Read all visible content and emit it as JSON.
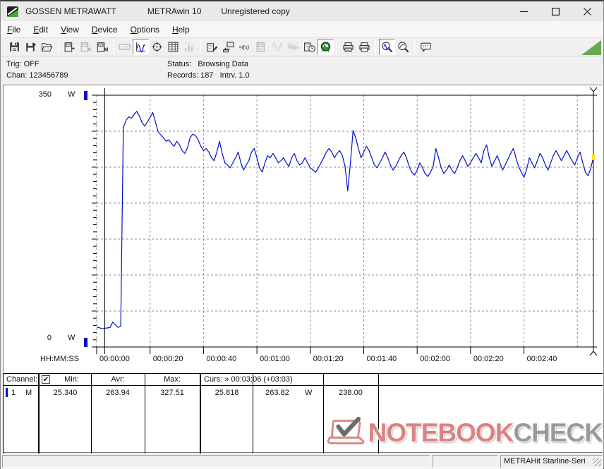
{
  "window": {
    "title_brand": "GOSSEN METRAWATT",
    "title_app": "METRAwin 10",
    "title_license": "Unregistered copy"
  },
  "menu": {
    "items": [
      {
        "label": "File"
      },
      {
        "label": "Edit"
      },
      {
        "label": "View"
      },
      {
        "label": "Device"
      },
      {
        "label": "Options"
      },
      {
        "label": "Help"
      }
    ]
  },
  "toolbar": {
    "buttons": [
      {
        "icon": "save-icon"
      },
      {
        "icon": "save-data-icon"
      },
      {
        "icon": "open-file-icon"
      },
      {
        "sep": true
      },
      {
        "icon": "device-read-icon"
      },
      {
        "icon": "device-clear-icon",
        "disabled": true
      },
      {
        "icon": "device-memory-icon"
      },
      {
        "sep": true
      },
      {
        "icon": "lcd-display-icon",
        "disabled": true
      },
      {
        "icon": "chart-view-icon",
        "pressed": true
      },
      {
        "icon": "cursor-crosshair-icon"
      },
      {
        "icon": "table-view-icon"
      },
      {
        "icon": "histogram-view-icon",
        "disabled": true
      },
      {
        "sep": true
      },
      {
        "icon": "device-config-icon"
      },
      {
        "icon": "data-transfer-icon"
      },
      {
        "icon": "formula-icon"
      },
      {
        "icon": "device-offline-icon",
        "disabled": true
      },
      {
        "icon": "sine-signal-icon",
        "disabled": true
      },
      {
        "icon": "noise-signal-icon",
        "disabled": true
      },
      {
        "icon": "schedule-icon"
      },
      {
        "icon": "meter-live-icon",
        "pressed": true
      },
      {
        "sep": true
      },
      {
        "icon": "print-report-icon"
      },
      {
        "icon": "print-icon"
      },
      {
        "sep": true
      },
      {
        "icon": "zoom-signal-icon",
        "pressed": true
      },
      {
        "icon": "zoom-curve-icon"
      },
      {
        "sep": true
      },
      {
        "icon": "comment-icon"
      }
    ]
  },
  "status_panel": {
    "trig": "Trig: OFF",
    "chan": "Chan: 123456789",
    "status": "Status:   Browsing Data",
    "records": "Records: 187   Intrv. 1.0"
  },
  "chart_data": {
    "type": "line",
    "unit": "W",
    "ylim": [
      0,
      350
    ],
    "y_max_label": "350",
    "y_max_unit": "W",
    "y_min_label": "0",
    "y_min_unit": "W",
    "xlabel": "HH:MM:SS",
    "x_tick_interval_s": 20,
    "x_ticks": [
      "00:00:00",
      "00:00:20",
      "00:00:40",
      "00:01:00",
      "00:01:20",
      "00:01:40",
      "00:02:00",
      "00:02:20",
      "00:02:40"
    ],
    "record_interval_s": 1.0,
    "records": 187,
    "grid": true,
    "series": [
      {
        "name": "Channel 1",
        "color": "#0010cc",
        "values": [
          27.5,
          26.8,
          25.34,
          26.1,
          26.5,
          27.2,
          34.5,
          31.0,
          27.3,
          29.0,
          305,
          315,
          320,
          318,
          323,
          327.51,
          321,
          312,
          307,
          313,
          319,
          326,
          313,
          299,
          295,
          291,
          286,
          288,
          283,
          279,
          286,
          281,
          273,
          269,
          277,
          291,
          296,
          294,
          288,
          279,
          273,
          276,
          271,
          263,
          259,
          271,
          286,
          269,
          256,
          253,
          249,
          256,
          263,
          271,
          256,
          246,
          253,
          259,
          271,
          276,
          263,
          249,
          243,
          256,
          266,
          263,
          269,
          263,
          256,
          259,
          263,
          256,
          251,
          263,
          269,
          259,
          253,
          256,
          263,
          256,
          249,
          246,
          243,
          249,
          256,
          263,
          271,
          276,
          271,
          263,
          269,
          273,
          266,
          251,
          217,
          256,
          301,
          291,
          276,
          263,
          271,
          279,
          273,
          263,
          253,
          249,
          256,
          263,
          271,
          263,
          253,
          246,
          251,
          259,
          266,
          271,
          263,
          251,
          243,
          239,
          246,
          256,
          249,
          241,
          237,
          243,
          251,
          276,
          263,
          249,
          241,
          246,
          253,
          246,
          241,
          249,
          259,
          266,
          259,
          251,
          256,
          263,
          269,
          263,
          256,
          273,
          281,
          263,
          251,
          259,
          266,
          256,
          246,
          253,
          261,
          269,
          276,
          263,
          251,
          243,
          236,
          247,
          263,
          256,
          249,
          259,
          269,
          263,
          253,
          246,
          256,
          266,
          273,
          266,
          259,
          266,
          273,
          266,
          259,
          253,
          263,
          271,
          256,
          243,
          238,
          248,
          263.8
        ]
      }
    ],
    "cursors": {
      "a_time_s": 3,
      "b_time_s": 186,
      "b_time_label": "00:03:06",
      "delta_label": "+03:03"
    }
  },
  "table": {
    "header": {
      "channel": "Channel:",
      "checkbox_checked": "✔",
      "min": "Min:",
      "avr": "Avr:",
      "max": "Max:",
      "curs": "Curs: » 00:03:06 (+03:03)"
    },
    "row": {
      "channel_num": "1",
      "channel_mode": "M",
      "min": "25.340",
      "avr": "263.94",
      "max": "327.51",
      "cursor_a": "25.818",
      "cursor_b": "263.82",
      "cursor_b_unit": "W",
      "delta": "238.00"
    }
  },
  "watermark": {
    "text_primary": "NOTEBOOK",
    "text_secondary": "CHECK"
  },
  "status_bar": {
    "device": "METRAHit Starline-Seri"
  },
  "colors": {
    "curve": "#0010cc",
    "grid": "#8c8c8c",
    "cursor_marker": "#ffe600",
    "channel_marker": "#0010cc",
    "triangle": "#6aa84f",
    "watermark_red": "#dd8181",
    "watermark_gray": "#9a9a9a"
  }
}
